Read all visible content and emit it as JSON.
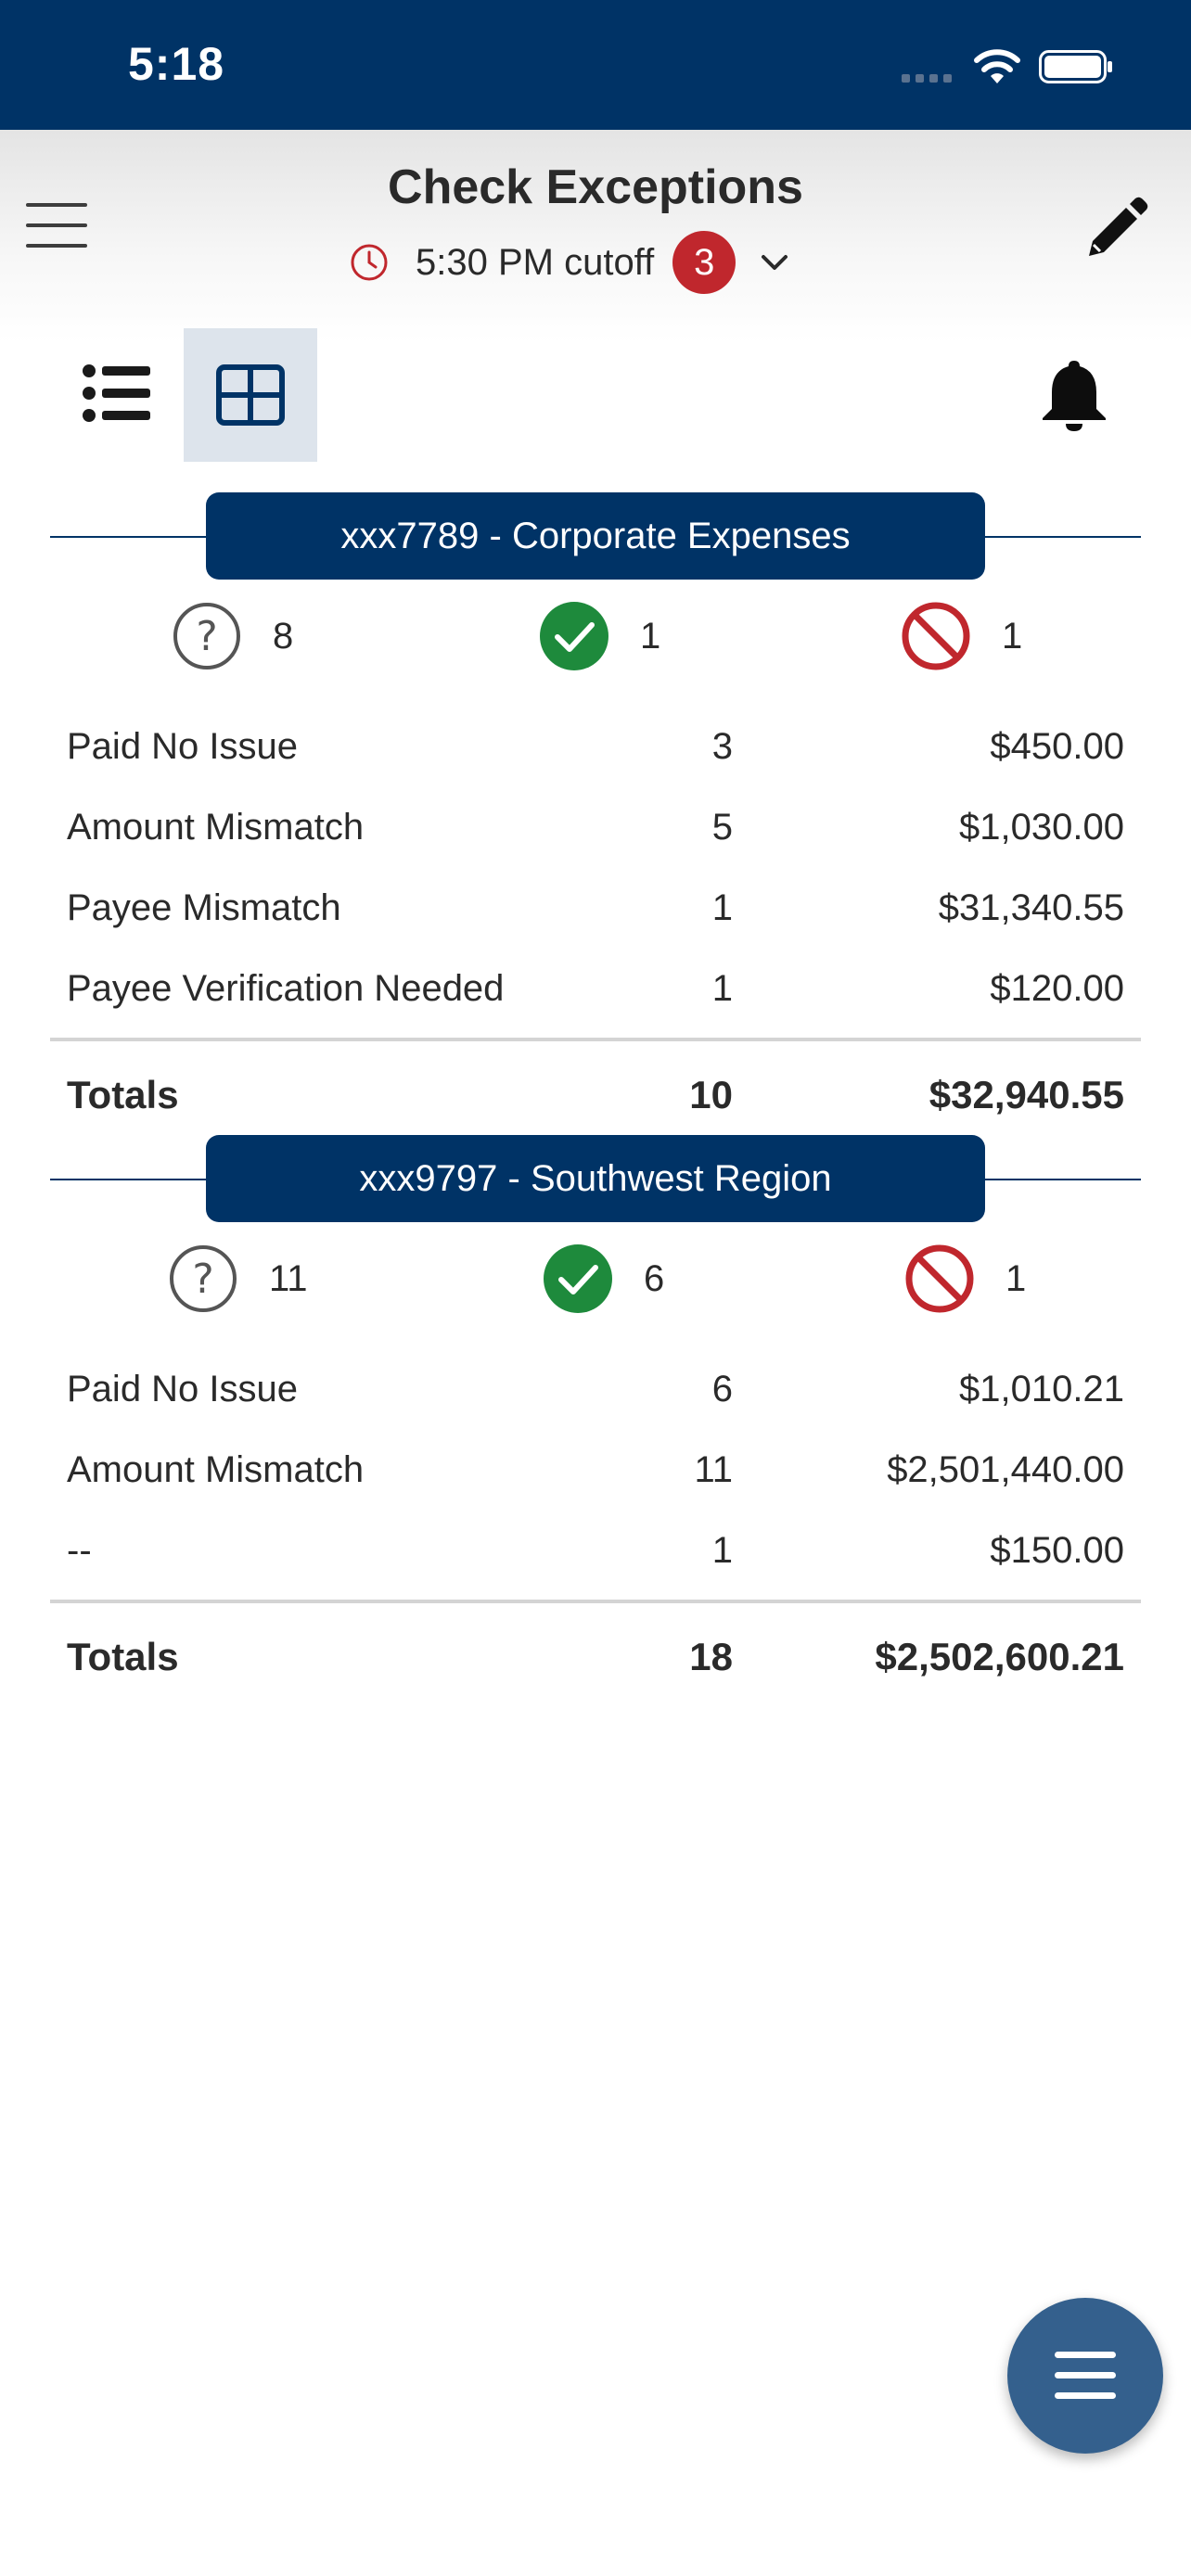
{
  "status_bar": {
    "time": "5:18"
  },
  "header": {
    "title": "Check Exceptions",
    "cutoff_text": "5:30 PM cutoff",
    "badge_count": "3"
  },
  "colors": {
    "primary": "#003366",
    "badge": "#c0272d",
    "approved": "#1e8a3c",
    "rejected": "#c0272d",
    "pending": "#555555",
    "fab": "#34608d"
  },
  "icons": {
    "menu": "hamburger-icon",
    "time": "clock-icon",
    "expand": "chevron-down-icon",
    "edit": "pencil-icon",
    "list_view": "list-view-icon",
    "grid_view": "grid-view-icon",
    "notifications": "bell-icon",
    "pending": "question-circle-icon",
    "approved": "check-circle-icon",
    "rejected": "prohibited-icon",
    "fab": "menu-icon"
  },
  "accounts": [
    {
      "name": "xxx7789 - Corporate Expenses",
      "pending_count": "8",
      "approved_count": "1",
      "rejected_count": "1",
      "rows": [
        {
          "label": "Paid No Issue",
          "count": "3",
          "amount": "$450.00"
        },
        {
          "label": "Amount Mismatch",
          "count": "5",
          "amount": "$1,030.00"
        },
        {
          "label": "Payee Mismatch",
          "count": "1",
          "amount": "$31,340.55"
        },
        {
          "label": "Payee Verification Needed",
          "count": "1",
          "amount": "$120.00"
        }
      ],
      "totals": {
        "label": "Totals",
        "count": "10",
        "amount": "$32,940.55"
      }
    },
    {
      "name": "xxx9797 - Southwest Region",
      "pending_count": "11",
      "approved_count": "6",
      "rejected_count": "1",
      "rows": [
        {
          "label": "Paid No Issue",
          "count": "6",
          "amount": "$1,010.21"
        },
        {
          "label": "Amount Mismatch",
          "count": "11",
          "amount": "$2,501,440.00"
        },
        {
          "label": "--",
          "count": "1",
          "amount": "$150.00"
        }
      ],
      "totals": {
        "label": "Totals",
        "count": "18",
        "amount": "$2,502,600.21"
      }
    }
  ]
}
